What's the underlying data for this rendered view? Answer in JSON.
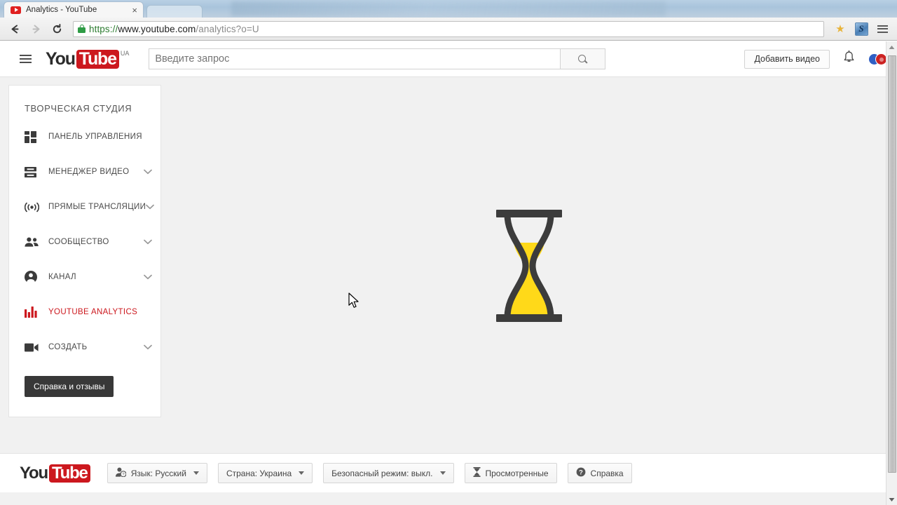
{
  "browser": {
    "tab": {
      "title": "Analytics - YouTube",
      "favicon": "youtube-favicon",
      "close": "×"
    },
    "nav": {
      "back": "back-arrow",
      "forward": "forward-arrow",
      "reload": "reload-icon"
    },
    "url": {
      "scheme": "https://",
      "host": "www.youtube.com",
      "path": "/analytics?o=U",
      "lock": "secure-lock-icon"
    },
    "actions": {
      "bookmark": "★",
      "extension": "S",
      "menu": "chrome-menu-icon"
    }
  },
  "masthead": {
    "menu_icon": "hamburger-icon",
    "logo": {
      "you": "You",
      "tube": "Tube",
      "country": "UA"
    },
    "search": {
      "placeholder": "Введите запрос",
      "value": "",
      "button_icon": "search-icon"
    },
    "upload_label": "Добавить видео",
    "notifications_icon": "bell-icon",
    "account_icon": "account-avatars"
  },
  "sidebar": {
    "title": "ТВОРЧЕСКАЯ СТУДИЯ",
    "items": [
      {
        "label": "ПАНЕЛЬ УПРАВЛЕНИЯ",
        "icon": "dashboard-icon",
        "expandable": false,
        "active": false
      },
      {
        "label": "МЕНЕДЖЕР ВИДЕО",
        "icon": "video-manager-icon",
        "expandable": true,
        "active": false
      },
      {
        "label": "ПРЯМЫЕ ТРАНСЛЯЦИИ",
        "icon": "live-broadcast-icon",
        "expandable": true,
        "active": false
      },
      {
        "label": "СООБЩЕСТВО",
        "icon": "community-people-icon",
        "expandable": true,
        "active": false
      },
      {
        "label": "КАНАЛ",
        "icon": "channel-person-icon",
        "expandable": true,
        "active": false
      },
      {
        "label": "YOUTUBE ANALYTICS",
        "icon": "analytics-bars-icon",
        "expandable": false,
        "active": true
      },
      {
        "label": "СОЗДАТЬ",
        "icon": "create-camera-icon",
        "expandable": true,
        "active": false
      }
    ],
    "help_button": "Справка и отзывы"
  },
  "main": {
    "loading_icon": "hourglass-loading-icon",
    "hourglass_frame_color": "#3c3c3c",
    "hourglass_sand_color": "#ffd919",
    "cursor": "mouse-pointer"
  },
  "footer": {
    "logo": {
      "you": "You",
      "tube": "Tube"
    },
    "buttons": [
      {
        "label": "Язык: Русский",
        "icon": "language-person-icon",
        "caret": true
      },
      {
        "label": "Страна: Украина",
        "icon": "",
        "caret": true
      },
      {
        "label": "Безопасный режим: выкл.",
        "icon": "",
        "caret": true
      },
      {
        "label": "Просмотренные",
        "icon": "hourglass-small-icon",
        "caret": false
      },
      {
        "label": "Справка",
        "icon": "question-mark-icon",
        "caret": false
      }
    ]
  },
  "colors": {
    "brand_red": "#cc181e",
    "page_bg": "#f1f1f1",
    "panel_bg": "#ffffff",
    "sand_yellow": "#ffd919",
    "frame_gray": "#3c3c3c"
  }
}
